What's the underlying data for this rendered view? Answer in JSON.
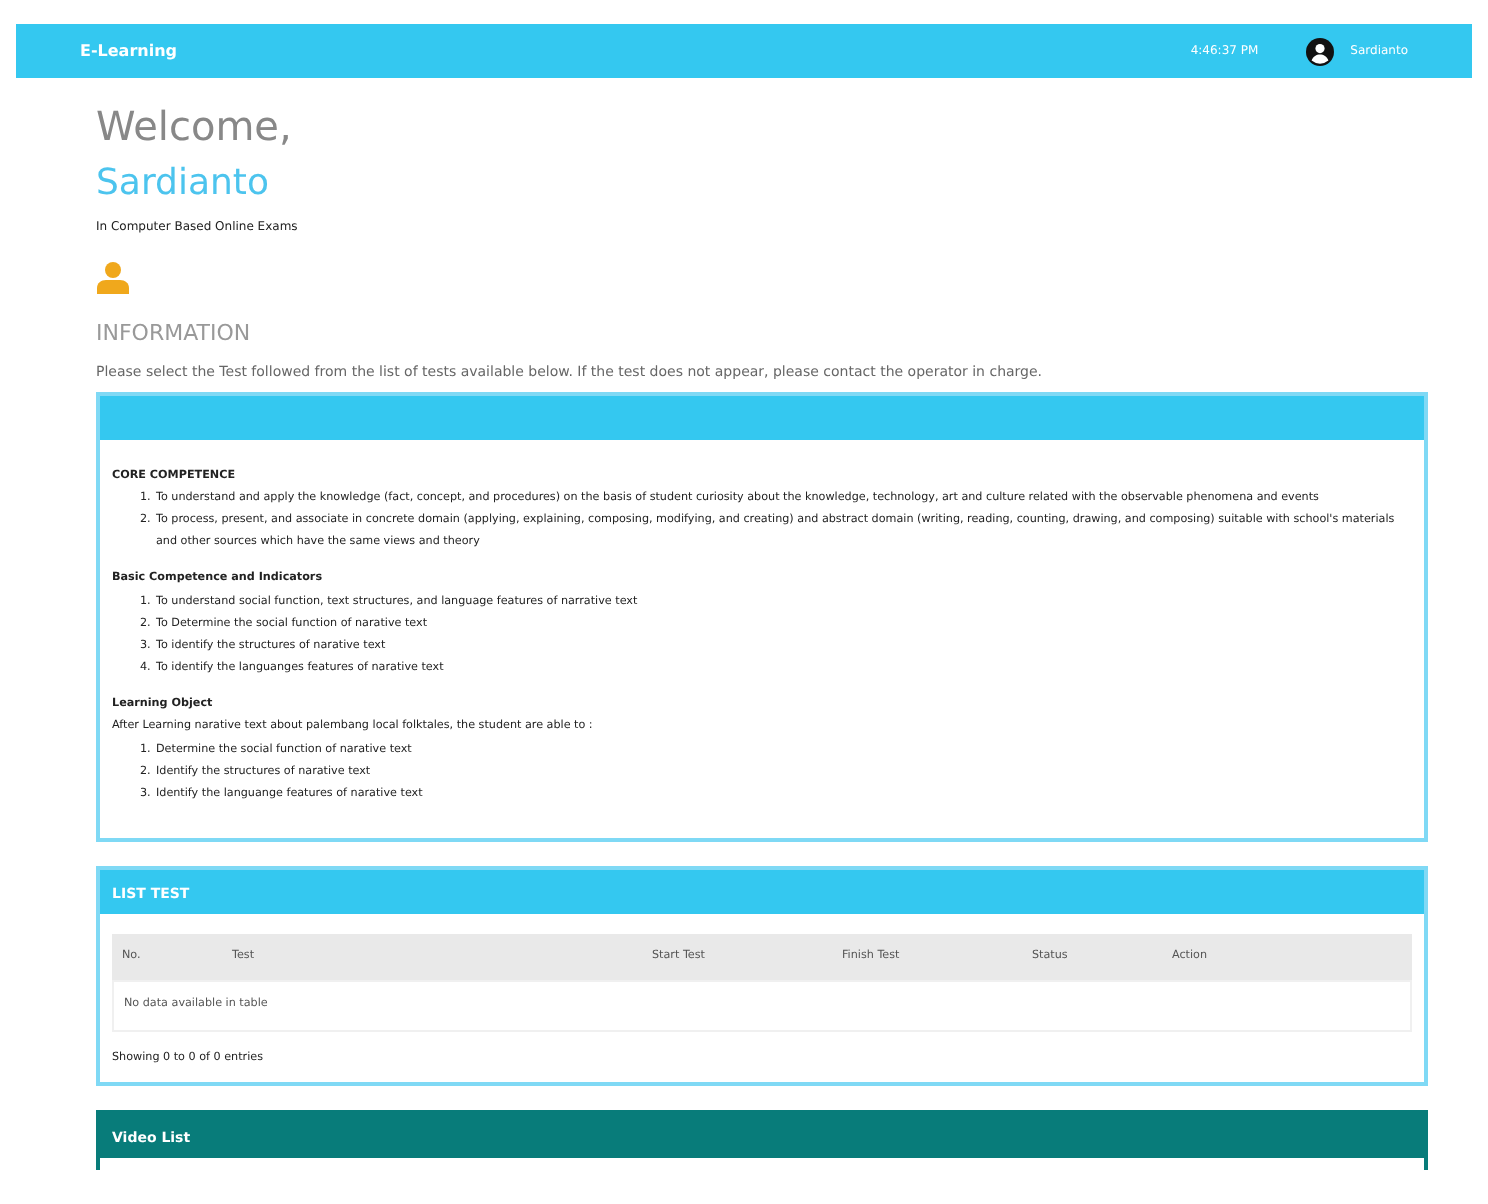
{
  "navbar": {
    "brand": "E-Learning",
    "time": "4:46:37 PM",
    "user": "Sardianto"
  },
  "welcome": {
    "greeting": "Welcome,",
    "name": "Sardianto",
    "subtitle": "In Computer Based Online Exams"
  },
  "information": {
    "title": "INFORMATION",
    "text": "Please select the Test followed from the list of tests available below. If the test does not appear, please contact the operator in charge."
  },
  "info_card": {
    "sections": [
      {
        "heading": "CORE COMPETENCE",
        "items": [
          {
            "marker": "1.",
            "text": "To understand and apply the knowledge (fact, concept, and procedures) on the basis of student curiosity about the knowledge, technology, art and culture related with the observable phenomena and events"
          },
          {
            "marker": "2.",
            "text": "To process, present, and associate in concrete domain (applying, explaining, composing, modifying, and creating) and abstract domain (writing, reading, counting, drawing, and composing) suitable with school's materials and other sources which have the same views and theory"
          }
        ]
      },
      {
        "heading": "Basic Competence and Indicators",
        "items": [
          {
            "marker": "1.",
            "text": "To understand social function, text structures, and language features of narrative text"
          },
          {
            "marker": "2.",
            "text": "To Determine the social function of narative text"
          },
          {
            "marker": "3.",
            "text": "To identify the structures of narative text"
          },
          {
            "marker": "4.",
            "text": "To identify the languanges features of narative text"
          }
        ]
      },
      {
        "heading": "Learning Object",
        "intro": "After Learning narative text about palembang local folktales, the student are able to :",
        "items": [
          {
            "marker": "1.",
            "text": "Determine the social function of narative text"
          },
          {
            "marker": "2.",
            "text": "Identify the structures of narative text"
          },
          {
            "marker": "3.",
            "text": "Identify the languange features of narative text"
          }
        ]
      }
    ]
  },
  "list_test": {
    "title": "LIST TEST",
    "columns": [
      "No.",
      "Test",
      "Start Test",
      "Finish Test",
      "Status",
      "Action"
    ],
    "empty_message": "No data available in table",
    "footer": "Showing 0 to 0 of 0 entries"
  },
  "video_list": {
    "title": "Video List"
  }
}
